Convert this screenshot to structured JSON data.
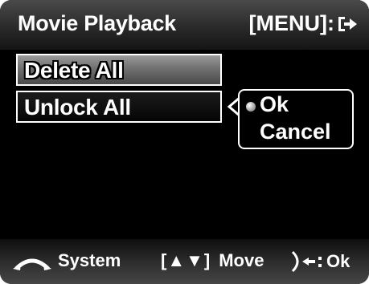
{
  "header": {
    "title": "Movie Playback",
    "menu_hint": "[MENU]:",
    "exit_icon": "exit-arrow-icon"
  },
  "menu": {
    "items": [
      {
        "label": "Delete All",
        "state": "normal"
      },
      {
        "label": "Unlock All",
        "state": "selected"
      }
    ]
  },
  "popup": {
    "options": [
      {
        "label": "Ok",
        "selected": true
      },
      {
        "label": "Cancel",
        "selected": false
      }
    ]
  },
  "footer": {
    "system_label": "System",
    "move_symbol": "[▲▼]",
    "move_label": "Move",
    "ok_label": "Ok"
  },
  "colors": {
    "background": "#000000",
    "text": "#ffffff",
    "header_top": "#4a4a4a",
    "item_normal": "#707070"
  }
}
